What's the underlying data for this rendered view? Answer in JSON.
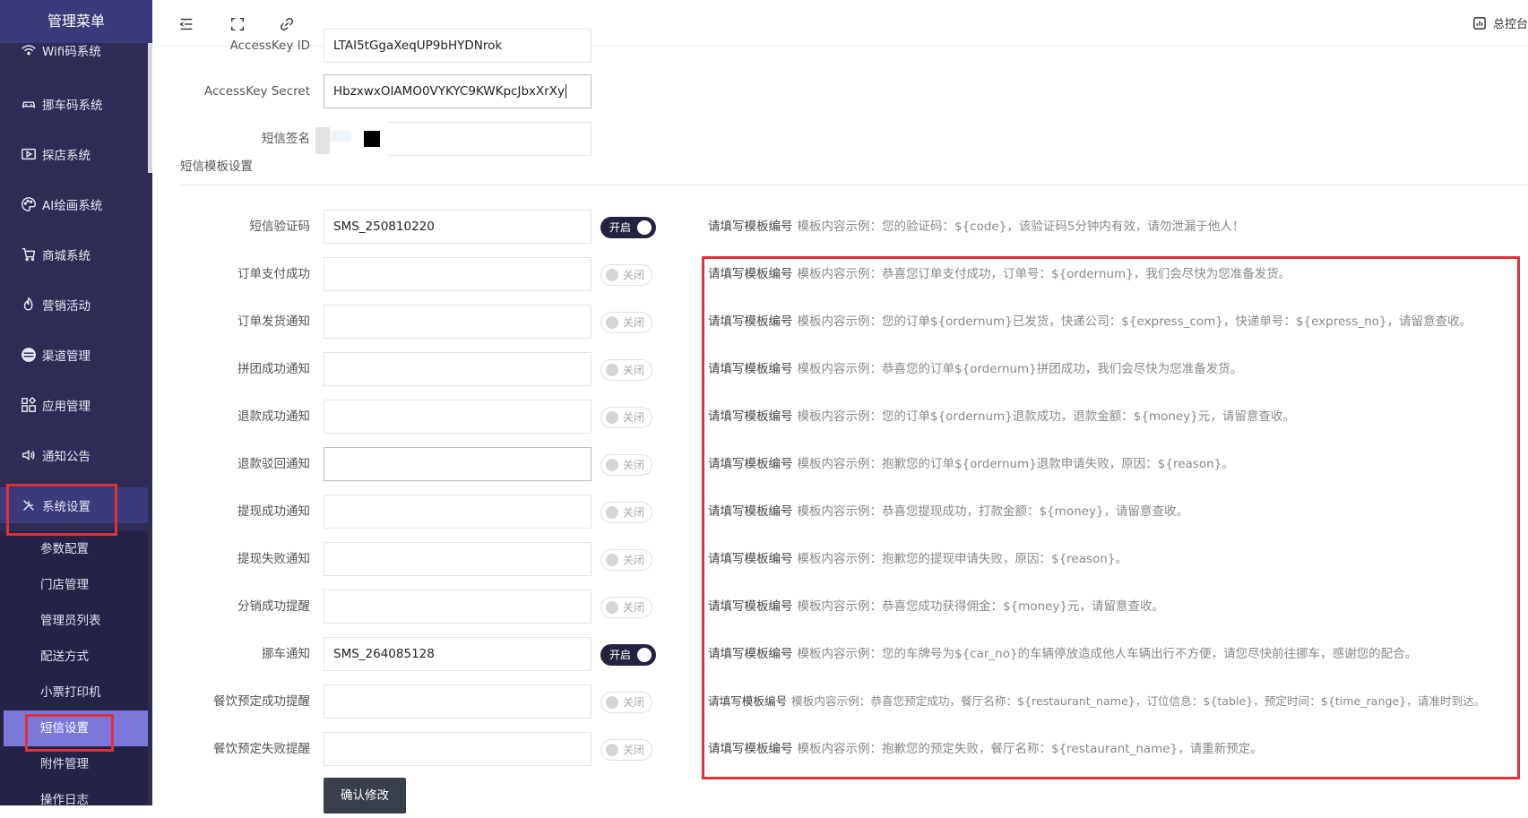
{
  "sidebar": {
    "title": "管理菜单",
    "items": [
      {
        "label": "Wifi码系统",
        "icon": "wifi-icon"
      },
      {
        "label": "挪车码系统",
        "icon": "car-icon"
      },
      {
        "label": "探店系统",
        "icon": "video-icon"
      },
      {
        "label": "AI绘画系统",
        "icon": "palette-icon"
      },
      {
        "label": "商城系统",
        "icon": "cart-icon"
      },
      {
        "label": "营销活动",
        "icon": "fire-icon"
      },
      {
        "label": "渠道管理",
        "icon": "channel-icon"
      },
      {
        "label": "应用管理",
        "icon": "apps-icon"
      },
      {
        "label": "通知公告",
        "icon": "speaker-icon"
      },
      {
        "label": "系统设置",
        "icon": "tools-icon"
      }
    ],
    "submenu": [
      {
        "label": "参数配置"
      },
      {
        "label": "门店管理"
      },
      {
        "label": "管理员列表"
      },
      {
        "label": "配送方式"
      },
      {
        "label": "小票打印机"
      },
      {
        "label": "短信设置"
      },
      {
        "label": "附件管理"
      },
      {
        "label": "操作日志"
      }
    ]
  },
  "topbar": {
    "console_label": "总控台"
  },
  "form": {
    "access_key_id_label": "AccessKey ID",
    "access_key_id_value": "LTAI5tGgaXeqUP9bHYDNrok",
    "access_key_secret_label": "AccessKey Secret",
    "access_key_secret_value": "HbzxwxOIAMO0VYKYC9KWKpcJbxXrXy",
    "sign_label": "短信签名",
    "sign_value": "",
    "template_section_title": "短信模板设置",
    "hint_prefix": "请填写模板编号",
    "on_label": "开启",
    "off_label": "关闭",
    "templates": [
      {
        "label": "短信验证码",
        "value": "SMS_250810220",
        "enabled": true,
        "example": "模板内容示例：您的验证码：${code}，该验证码5分钟内有效，请勿泄漏于他人！"
      },
      {
        "label": "订单支付成功",
        "value": "",
        "enabled": false,
        "example": "模板内容示例：恭喜您订单支付成功，订单号：${ordernum}，我们会尽快为您准备发货。"
      },
      {
        "label": "订单发货通知",
        "value": "",
        "enabled": false,
        "example": "模板内容示例：您的订单${ordernum}已发货，快递公司：${express_com}，快递单号：${express_no}，请留意查收。"
      },
      {
        "label": "拼团成功通知",
        "value": "",
        "enabled": false,
        "example": "模板内容示例：恭喜您的订单${ordernum}拼团成功，我们会尽快为您准备发货。"
      },
      {
        "label": "退款成功通知",
        "value": "",
        "enabled": false,
        "example": "模板内容示例：您的订单${ordernum}退款成功，退款金额：${money}元，请留意查收。"
      },
      {
        "label": "退款驳回通知",
        "value": "",
        "enabled": false,
        "example": "模板内容示例：抱歉您的订单${ordernum}退款申请失败，原因：${reason}。"
      },
      {
        "label": "提现成功通知",
        "value": "",
        "enabled": false,
        "example": "模板内容示例：恭喜您提现成功，打款金额：${money}，请留意查收。"
      },
      {
        "label": "提现失败通知",
        "value": "",
        "enabled": false,
        "example": "模板内容示例：抱歉您的提现申请失败，原因：${reason}。"
      },
      {
        "label": "分销成功提醒",
        "value": "",
        "enabled": false,
        "example": "模板内容示例：恭喜您成功获得佣金：${money}元，请留意查收。"
      },
      {
        "label": "挪车通知",
        "value": "SMS_264085128",
        "enabled": true,
        "example": "模板内容示例：您的车牌号为${car_no}的车辆停放造成他人车辆出行不方便，请您尽快前往挪车，感谢您的配合。"
      },
      {
        "label": "餐饮预定成功提醒",
        "value": "",
        "enabled": false,
        "example": "模板内容示例：恭喜您预定成功，餐厅名称：${restaurant_name}，订位信息：${table}，预定时间：${time_range}，请准时到达。"
      },
      {
        "label": "餐饮预定失败提醒",
        "value": "",
        "enabled": false,
        "example": "模板内容示例：抱歉您的预定失败，餐厅名称：${restaurant_name}，请重新预定。"
      }
    ],
    "submit_label": "确认修改"
  },
  "colors": {
    "sidebar_bg": "#2e2c55",
    "sidebar_active": "#3b3a7a",
    "submenu_active": "#7c78d9",
    "switch_on": "#23233f",
    "highlight": "#e0303c"
  }
}
